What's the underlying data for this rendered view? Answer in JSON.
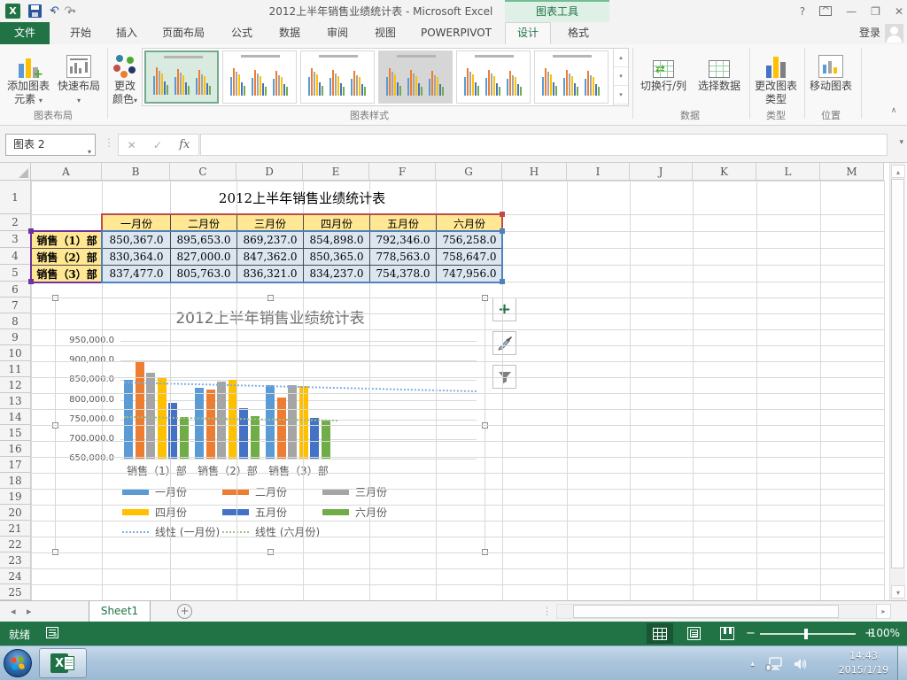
{
  "title_bar": {
    "title": "2012上半年销售业绩统计表 - Microsoft Excel",
    "context_header": "图表工具",
    "sign_in": "登录"
  },
  "icons": {
    "dropdown": "▾",
    "up": "▴",
    "down": "▾",
    "left": "◂",
    "right": "▸",
    "close": "✕",
    "minimize": "—",
    "restore": "❐",
    "help": "?",
    "check": "✓",
    "cancel": "✕",
    "undo": "↶",
    "redo": "↷",
    "plus": "+",
    "minus": "−",
    "vdots": "⋮",
    "hdots": "⋯⋯",
    "collapse": "∧",
    "add_sheet": "+",
    "ribbon_display": "^"
  },
  "tabs": [
    {
      "label": "文件",
      "type": "file"
    },
    {
      "label": "开始"
    },
    {
      "label": "插入"
    },
    {
      "label": "页面布局"
    },
    {
      "label": "公式"
    },
    {
      "label": "数据"
    },
    {
      "label": "审阅"
    },
    {
      "label": "视图"
    },
    {
      "label": "POWERPIVOT"
    },
    {
      "label": "设计",
      "contextual": true,
      "selected": true
    },
    {
      "label": "格式",
      "contextual": true
    }
  ],
  "ribbon": {
    "groups": [
      {
        "label": "图表布局",
        "buttons": [
          {
            "label": "添加图表元素"
          },
          {
            "label": "快速布局"
          }
        ]
      },
      {
        "label": "图表样式",
        "buttons": [
          {
            "label": "更改颜色"
          }
        ]
      },
      {
        "label": "数据",
        "buttons": [
          {
            "label": "切换行/列"
          },
          {
            "label": "选择数据"
          }
        ]
      },
      {
        "label": "类型",
        "buttons": [
          {
            "label": "更改图表类型"
          }
        ]
      },
      {
        "label": "位置",
        "buttons": [
          {
            "label": "移动图表"
          }
        ]
      }
    ],
    "chart_styles": {
      "selected_index": 0,
      "count": 6,
      "gray_index": 3
    }
  },
  "formula_bar": {
    "name_box": "图表 2",
    "fx_label": "fx",
    "value": ""
  },
  "sheet": {
    "columns": [
      "A",
      "B",
      "C",
      "D",
      "E",
      "F",
      "G",
      "H",
      "I",
      "J",
      "K",
      "L",
      "M"
    ],
    "row_count": 25,
    "active_sheet": "Sheet1"
  },
  "table": {
    "title": "2012上半年销售业绩统计表",
    "months": [
      "一月份",
      "二月份",
      "三月份",
      "四月份",
      "五月份",
      "六月份"
    ],
    "rows": [
      {
        "name": "销售（1）部",
        "values": [
          "850,367.0",
          "895,653.0",
          "869,237.0",
          "854,898.0",
          "792,346.0",
          "756,258.0"
        ]
      },
      {
        "name": "销售（2）部",
        "values": [
          "830,364.0",
          "827,000.0",
          "847,362.0",
          "850,365.0",
          "778,563.0",
          "758,647.0"
        ]
      },
      {
        "name": "销售（3）部",
        "values": [
          "837,477.0",
          "805,763.0",
          "836,321.0",
          "834,237.0",
          "754,378.0",
          "747,956.0"
        ]
      }
    ],
    "colors": {
      "header_fill": "#FFE793",
      "data_fill": "#DCE6F1",
      "category_range_border": "#BE4B48",
      "series_range_border": "#7030A0",
      "value_range_border": "#4F81BD"
    }
  },
  "chart_data": {
    "type": "bar",
    "title": "2012上半年销售业绩统计表",
    "categories": [
      "销售（1）部",
      "销售（2）部",
      "销售（3）部"
    ],
    "series": [
      {
        "name": "一月份",
        "color": "#5B9BD5",
        "values": [
          850367,
          830364,
          837477
        ]
      },
      {
        "name": "二月份",
        "color": "#ED7D31",
        "values": [
          895653,
          827000,
          805763
        ]
      },
      {
        "name": "三月份",
        "color": "#A5A5A5",
        "values": [
          869237,
          847362,
          836321
        ]
      },
      {
        "name": "四月份",
        "color": "#FFC000",
        "values": [
          854898,
          850365,
          834237
        ]
      },
      {
        "name": "五月份",
        "color": "#4472C4",
        "values": [
          792346,
          778563,
          754378
        ]
      },
      {
        "name": "六月份",
        "color": "#70AD47",
        "values": [
          756258,
          758647,
          747956
        ]
      }
    ],
    "trendlines": [
      {
        "name": "线性 (一月份)",
        "color": "#7FAFDF"
      },
      {
        "name": "线性 (六月份)",
        "color": "#9CBF8A"
      }
    ],
    "ylim": [
      650000,
      950000
    ],
    "ytick_step": 50000,
    "ytick_labels": [
      "950,000.0",
      "900,000.0",
      "850,000.0",
      "800,000.0",
      "750,000.0",
      "700,000.0",
      "650,000.0"
    ],
    "grid": true,
    "legend_position": "bottom"
  },
  "status_bar": {
    "ready": "就绪",
    "zoom_level": "100%"
  },
  "taskbar": {
    "time": "14:43",
    "date": "2015/1/19"
  }
}
